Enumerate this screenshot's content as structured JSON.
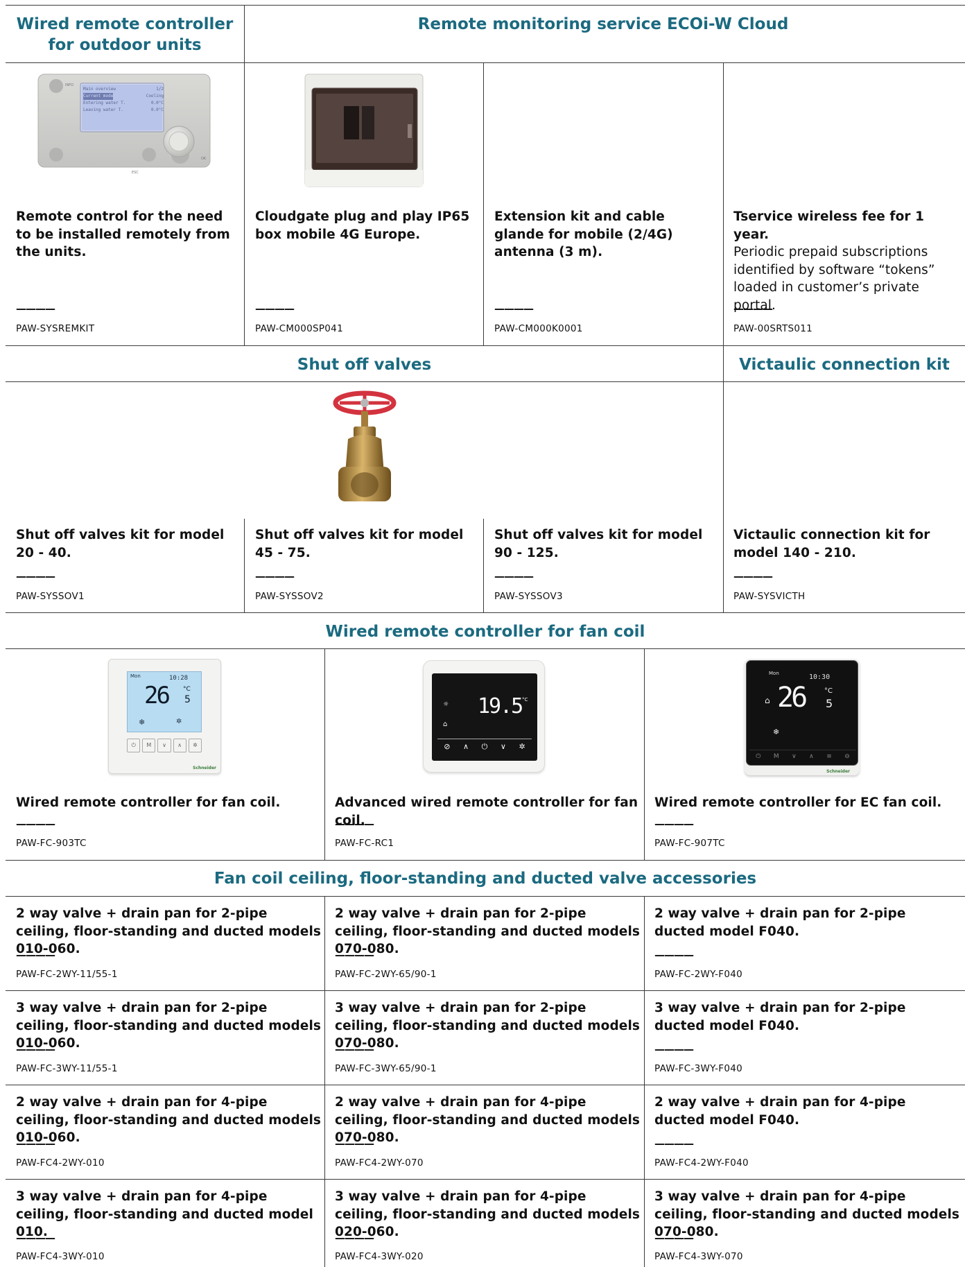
{
  "sections": {
    "remote_outdoor": "Wired remote controller for outdoor units",
    "ecoi_cloud": "Remote monitoring service ECOi-W Cloud",
    "shut_off": "Shut off valves",
    "victaulic": "Victaulic connection kit",
    "fan_coil_remote": "Wired remote controller for fan coil",
    "fan_coil_valves": "Fan coil ceiling, floor-standing and ducted valve accessories"
  },
  "dash": "————",
  "row1": [
    {
      "desc": "Remote control for the need to be installed remotely from the units.",
      "code": "PAW-SYSREMKIT"
    },
    {
      "desc": "Cloudgate plug and play IP65 box mobile 4G Europe.",
      "code": "PAW-CM000SP041"
    },
    {
      "desc": "Extension kit and cable glande for mobile (2/4G) antenna (3 m).",
      "code": "PAW-CM000K0001"
    },
    {
      "desc": "Tservice wireless fee for 1 year.",
      "desc2": "Periodic prepaid subscriptions identified by software “tokens” loaded in customer’s private portal.",
      "code": "PAW-00SRTS011"
    }
  ],
  "remote_screen": {
    "lines": [
      "Main overview",
      "Current mode",
      "Entering water T.",
      "Leaving water T."
    ],
    "values": [
      "1/2",
      "Cooling",
      "0.0°C",
      "0.0°C"
    ],
    "key1": "INFO",
    "key2": "ESC",
    "key3": "OK"
  },
  "row2": [
    {
      "desc": "Shut off valves kit for model 20 - 40.",
      "code": "PAW-SYSSOV1"
    },
    {
      "desc": "Shut off valves kit for model 45 - 75.",
      "code": "PAW-SYSSOV2"
    },
    {
      "desc": "Shut off valves kit for model 90 - 125.",
      "code": "PAW-SYSSOV3"
    },
    {
      "desc": "Victaulic connection kit for model 140 - 210.",
      "code": "PAW-SYSVICTH"
    }
  ],
  "row3": [
    {
      "desc": "Wired remote controller for fan coil.",
      "code": "PAW-FC-903TC"
    },
    {
      "desc": "Advanced wired remote controller for fan coil.",
      "code": "PAW-FC-RC1"
    },
    {
      "desc": "Wired remote controller for EC fan coil.",
      "code": "PAW-FC-907TC"
    }
  ],
  "thermostats": {
    "t1_time": "10:28",
    "t1_temp": "26",
    "t1_dec": "5",
    "t1_unit": "°C",
    "t2_temp": "19.5",
    "t2_unit": "°C",
    "t3_time": "10:30",
    "t3_temp": "26",
    "t3_dec": "5",
    "t3_unit": "°C",
    "day": "Mon",
    "brand": "Schneider",
    "mode_key": "M"
  },
  "valves": [
    [
      {
        "desc": "2 way valve + drain pan for 2-pipe ceiling, floor-standing and ducted models 010-060.",
        "code": "PAW-FC-2WY-11/55-1"
      },
      {
        "desc": "2 way valve + drain pan for 2-pipe ceiling, floor-standing and ducted models 070-080.",
        "code": "PAW-FC-2WY-65/90-1"
      },
      {
        "desc": "2 way valve + drain pan for 2-pipe ducted model F040.",
        "code": "PAW-FC-2WY-F040"
      }
    ],
    [
      {
        "desc": "3 way valve + drain pan for 2-pipe ceiling, floor-standing and ducted models 010-060.",
        "code": "PAW-FC-3WY-11/55-1"
      },
      {
        "desc": "3 way valve + drain pan for 2-pipe ceiling, floor-standing and ducted models 070-080.",
        "code": "PAW-FC-3WY-65/90-1"
      },
      {
        "desc": "3 way valve + drain pan for 2-pipe ducted model F040.",
        "code": "PAW-FC-3WY-F040"
      }
    ],
    [
      {
        "desc": "2 way valve + drain pan for 4-pipe ceiling, floor-standing and ducted models 010-060.",
        "code": "PAW-FC4-2WY-010"
      },
      {
        "desc": "2 way valve + drain pan for 4-pipe ceiling, floor-standing and ducted models 070-080.",
        "code": "PAW-FC4-2WY-070"
      },
      {
        "desc": "2 way valve + drain pan for 4-pipe ducted model F040.",
        "code": "PAW-FC4-2WY-F040"
      }
    ],
    [
      {
        "desc": "3 way valve + drain pan for 4-pipe ceiling, floor-standing and ducted model 010.",
        "code": "PAW-FC4-3WY-010"
      },
      {
        "desc": "3 way valve + drain pan for 4-pipe ceiling, floor-standing and ducted models 020-060.",
        "code": "PAW-FC4-3WY-020"
      },
      {
        "desc": "3 way valve + drain pan for 4-pipe ceiling, floor-standing and ducted models 070-080.",
        "code": "PAW-FC4-3WY-070"
      }
    ]
  ]
}
